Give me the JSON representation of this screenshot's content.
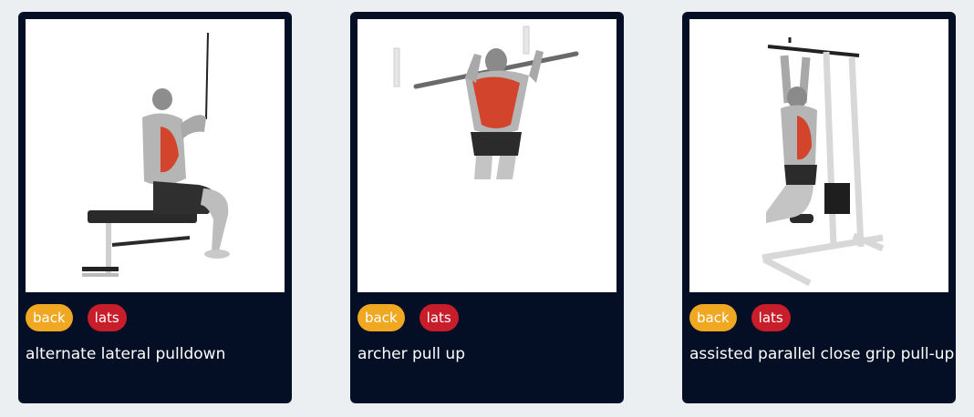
{
  "exercises": [
    {
      "name": "alternate lateral pulldown",
      "body_part": "back",
      "target": "lats",
      "image_icon": "lat-pulldown-illustration-icon"
    },
    {
      "name": "archer pull up",
      "body_part": "back",
      "target": "lats",
      "image_icon": "pull-up-illustration-icon"
    },
    {
      "name": "assisted parallel close grip pull-up",
      "body_part": "back",
      "target": "lats",
      "image_icon": "assisted-pull-up-illustration-icon"
    }
  ],
  "colors": {
    "card_bg": "#040f25",
    "body_part_tag": "#f0a722",
    "target_tag": "#c81d2a",
    "page_bg": "#eceff1"
  }
}
